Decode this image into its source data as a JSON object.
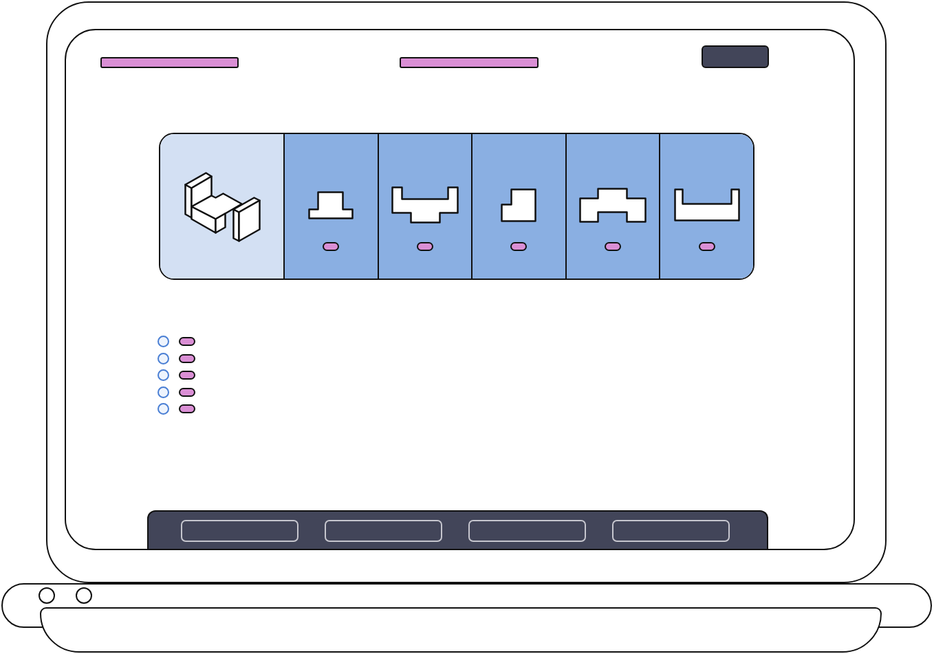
{
  "shape_panel": {
    "items": [
      {
        "kind": "solid"
      },
      {
        "kind": "tee"
      },
      {
        "kind": "channel"
      },
      {
        "kind": "corner"
      },
      {
        "kind": "bridge"
      },
      {
        "kind": "tray"
      }
    ]
  },
  "options": [
    {
      "selected": false
    },
    {
      "selected": false
    },
    {
      "selected": false
    },
    {
      "selected": false
    },
    {
      "selected": false
    }
  ]
}
